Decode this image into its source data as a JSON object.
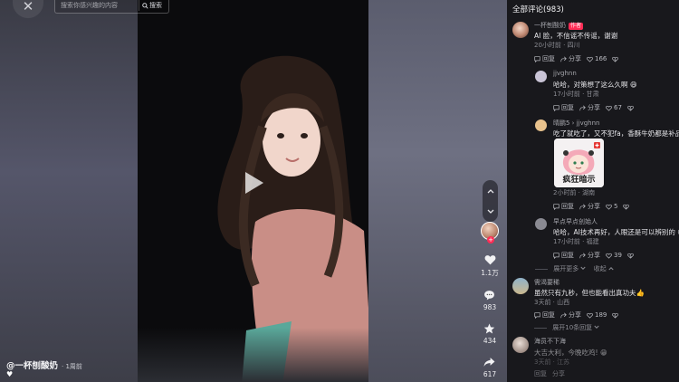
{
  "top": {
    "close_glyph": "✕",
    "search_placeholder": "搜索你感兴趣的内容",
    "search_button": "搜索"
  },
  "video": {
    "author_handle": "@一杯刨酸奶",
    "post_time": "· 1周前"
  },
  "rail": {
    "like_count": "1.1万",
    "comment_count": "983",
    "favorite_count": "434",
    "share_count": "617"
  },
  "comments": {
    "title": "全部评论(983)",
    "author_badge": "作者",
    "reply_label": "回复",
    "share_label": "分享",
    "items": [
      {
        "name": "一杯刨酸奶",
        "text": "AI 脸，不信谣不传谣，谢谢",
        "meta": "20小时前 · 四川",
        "likes": "166"
      },
      {
        "name": "jjvghnn",
        "text": "哈哈，对策想了这么久啊 😄",
        "meta": "17小时前 · 甘肃",
        "likes": "67"
      },
      {
        "name": "晴鹏5 › jjvghnn",
        "text": "吃了就吃了，又不犯fa，香酥牛奶都是补品",
        "meta": "2小时前 · 湖南",
        "likes": "5",
        "sticker_text": "疯狂暗示"
      },
      {
        "name": "早点早点创始人",
        "text": "哈哈，AI技术再好，人眼还是可以辨别的 😄",
        "meta": "17小时前 · 福建",
        "likes": "39"
      },
      {
        "name": "需渴要稀",
        "text": "虽然只有九秒，但也能看出真功夫👍",
        "meta": "3天前 · 山西",
        "likes": "189"
      },
      {
        "name": "海员不下海",
        "text": "大吉大利，今晚吃鸡! 😁",
        "meta": "3天前 · 江苏",
        "likes": ""
      }
    ],
    "expand_more": "展开更多",
    "collapse": "收起",
    "expand_replies": "展开10条回复"
  }
}
